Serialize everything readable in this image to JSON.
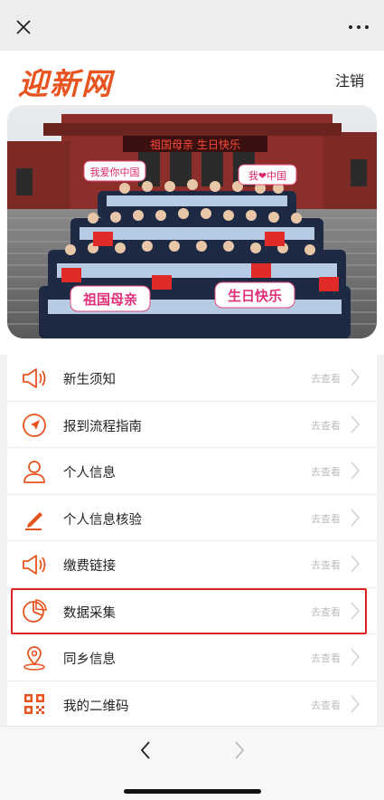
{
  "header": {
    "logo_text": "迎新网",
    "logout_label": "注销"
  },
  "hero": {
    "banner_text": "祖国母亲  生日快乐",
    "sign_left_top": "我爱你中国",
    "sign_right_top": "我❤中国",
    "sign_left_bottom": "祖国母亲",
    "sign_right_bottom": "生日快乐"
  },
  "menu": {
    "items": [
      {
        "label": "新生须知",
        "hint": "去查看",
        "icon": "megaphone-icon"
      },
      {
        "label": "报到流程指南",
        "hint": "去查看",
        "icon": "compass-icon"
      },
      {
        "label": "个人信息",
        "hint": "去查看",
        "icon": "user-icon"
      },
      {
        "label": "个人信息核验",
        "hint": "去查看",
        "icon": "pencil-icon"
      },
      {
        "label": "缴费链接",
        "hint": "去查看",
        "icon": "megaphone-icon"
      },
      {
        "label": "数据采集",
        "hint": "去查看",
        "icon": "pie-chart-icon"
      },
      {
        "label": "同乡信息",
        "hint": "去查看",
        "icon": "location-pin-icon"
      },
      {
        "label": "我的二维码",
        "hint": "去查看",
        "icon": "qr-code-icon"
      }
    ]
  },
  "colors": {
    "accent": "#e8541f",
    "highlight": "#e02020"
  }
}
